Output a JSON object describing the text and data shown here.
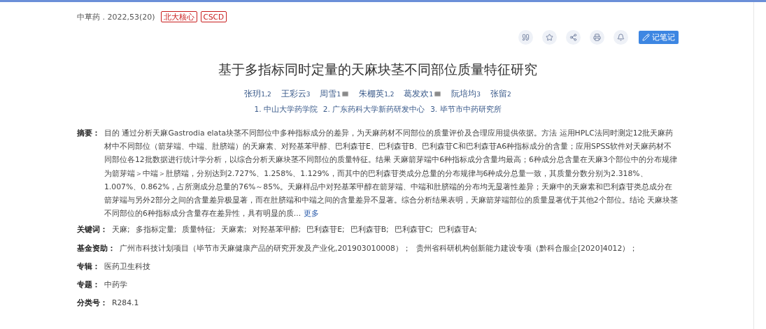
{
  "source": {
    "journal": "中草药 . 2022,53(20)",
    "tags": [
      "北大核心",
      "CSCD"
    ]
  },
  "toolbar": {
    "icons": [
      {
        "kind": "quote"
      },
      {
        "kind": "star"
      },
      {
        "kind": "share"
      },
      {
        "kind": "print"
      },
      {
        "kind": "bell"
      }
    ],
    "note_button": "记笔记"
  },
  "title": "基于多指标同时定量的天麻块茎不同部位质量特征研究",
  "authors": [
    {
      "name": "张玥",
      "sup": "1,2",
      "mail": false
    },
    {
      "name": "王彩云",
      "sup": "3",
      "mail": false
    },
    {
      "name": "周雪",
      "sup": "1",
      "mail": true
    },
    {
      "name": "朱棚英",
      "sup": "1,2",
      "mail": false
    },
    {
      "name": "葛发欢",
      "sup": "1",
      "mail": true
    },
    {
      "name": "阮培均",
      "sup": "3",
      "mail": false
    },
    {
      "name": "张留",
      "sup": "2",
      "mail": false
    }
  ],
  "affiliations": [
    "1. 中山大学药学院",
    "2. 广东药科大学新药研发中心",
    "3. 毕节市中药研究所"
  ],
  "abstract": {
    "label": "摘要：",
    "text": "目的 通过分析天麻Gastrodia elata块茎不同部位中多种指标成分的差异，为天麻药材不同部位的质量评价及合理应用提供依据。方法 运用HPLC法同时测定12批天麻药材中不同部位（箭芽端、中端、肚脐端）的天麻素、对羟基苯甲醇、巴利森苷E、巴利森苷B、巴利森苷C和巴利森苷A6种指标成分的含量；应用SPSS软件对天麻药材不同部位各12批数据进行统计学分析，以综合分析天麻块茎不同部位的质量特征。结果 天麻箭芽端中6种指标成分含量均最高；6种成分总含量在天麻3个部位中的分布规律为箭芽端＞中端＞肚脐端，分别达到2.727%、1.258%、1.129%，而其中的巴利森苷类成分总量的分布规律与6种成分总量一致，其质量分数分别为2.318%、1.007%、0.862%，占所测成分总量的76%～85%。天麻样品中对羟基苯甲醇在箭芽端、中端和肚脐端的分布均无显著性差异；天麻中的天麻素和巴利森苷类总成分在箭芽端与另外2部分之间的含量差异极显著，而在肚脐端和中端之间的含量差异不显著。综合分析结果表明，天麻箭芽端部位的质量显著优于其他2个部位。结论 天麻块茎不同部位的6种指标成分含量存在差异性，具有明显的质...",
    "more": "更多"
  },
  "keywords": {
    "label": "关键词：",
    "items": [
      "天麻;",
      "多指标定量;",
      "质量特征;",
      "天麻素;",
      "对羟基苯甲醇;",
      "巴利森苷E;",
      "巴利森苷B;",
      "巴利森苷C;",
      "巴利森苷A;"
    ]
  },
  "fund": {
    "label": "基金资助：",
    "items": [
      "广州市科技计划项目（毕节市天麻健康产品的研究开发及产业化,201903010008）；",
      "贵州省科研机构创新能力建设专项（黔科合服企[2020]4012）；"
    ]
  },
  "fields": [
    {
      "label": "专辑：",
      "value": "医药卫生科技"
    },
    {
      "label": "专题：",
      "value": "中药学"
    },
    {
      "label": "分类号：",
      "value": "R284.1"
    }
  ]
}
